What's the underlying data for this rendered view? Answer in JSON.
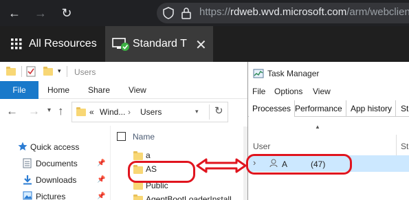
{
  "browser": {
    "url_prefix": "https://",
    "url_host": "rdweb.wvd.microsoft.com",
    "url_path": "/arm/webclient/in"
  },
  "rdweb": {
    "all_resources_label": "All Resources",
    "session_tab_label": "Standard T"
  },
  "explorer": {
    "title_path": "Users",
    "ribbon_tabs": [
      "File",
      "Home",
      "Share",
      "View"
    ],
    "address_chevron": "«",
    "address_segments": [
      "Wind...",
      "Users"
    ],
    "nav_items": [
      "Quick access",
      "Documents",
      "Downloads",
      "Pictures"
    ],
    "column_name": "Name",
    "files": [
      "a",
      "AS",
      "Public",
      "AgentBootLoaderInstall"
    ]
  },
  "task_manager": {
    "title": "Task Manager",
    "menu": [
      "File",
      "Options",
      "View"
    ],
    "tabs": [
      "Processes",
      "Performance",
      "App history",
      "St"
    ],
    "column_user": "User",
    "column_status": "Sta",
    "user_row_name": "A",
    "user_row_count": "(47)"
  },
  "colors": {
    "accent": "#1979ca",
    "annotation_red": "#e0141e",
    "selected_row": "#cce8ff"
  }
}
